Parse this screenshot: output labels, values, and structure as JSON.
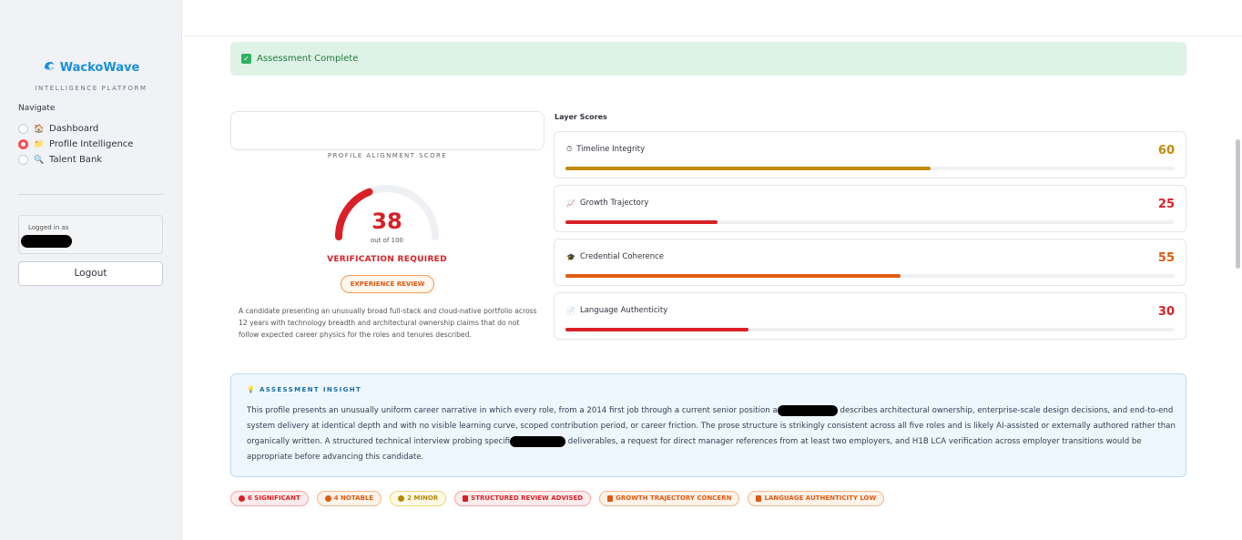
{
  "brand": {
    "name": "WackoWave",
    "subtitle": "INTELLIGENCE PLATFORM"
  },
  "nav": {
    "title": "Navigate",
    "items": [
      {
        "icon": "house-icon",
        "emoji": "🏠",
        "label": "Dashboard",
        "selected": false
      },
      {
        "icon": "folder-icon",
        "emoji": "📁",
        "label": "Profile Intelligence",
        "selected": true
      },
      {
        "icon": "magnifier-icon",
        "emoji": "🔍",
        "label": "Talent Bank",
        "selected": false
      }
    ]
  },
  "session": {
    "logged_in_label": "Logged in as",
    "logout_label": "Logout"
  },
  "alert": {
    "text": "Assessment Complete",
    "color": "#1e7a3c"
  },
  "score": {
    "label": "PROFILE ALIGNMENT SCORE",
    "value": "38",
    "value_num": 38,
    "out_of": "out of 100",
    "verdict": "VERIFICATION REQUIRED",
    "pill": "EXPERIENCE REVIEW",
    "description": "A candidate presenting an unusually broad full-stack and cloud-native portfolio across 12 years with technology breadth and architectural ownership claims that do not follow expected career physics for the roles and tenures described."
  },
  "layers": {
    "title": "Layer Scores",
    "items": [
      {
        "icon": "clock-icon",
        "emoji": "⏱",
        "label": "Timeline Integrity",
        "score": "60",
        "value": 60,
        "color": "#c48a0a"
      },
      {
        "icon": "chart-icon",
        "emoji": "📈",
        "label": "Growth Trajectory",
        "score": "25",
        "value": 25,
        "color": "#d92027"
      },
      {
        "icon": "graduation-cap-icon",
        "emoji": "🎓",
        "label": "Credential Coherence",
        "score": "55",
        "value": 55,
        "color": "#e05a12"
      },
      {
        "icon": "document-icon",
        "emoji": "📄",
        "label": "Language Authenticity",
        "score": "30",
        "value": 30,
        "color": "#d92027"
      }
    ]
  },
  "insight": {
    "title": "ASSESSMENT INSIGHT",
    "text_1": "This profile presents an unusually uniform career narrative in which every role, from a 2014 first job through a current senior position a",
    "text_2": "describes architectural ownership, enterprise-scale design decisions, and end-to-end system delivery at identical depth and with no visible learning curve, scoped contribution period, or career friction. The prose structure is strikingly consistent across all five roles and is likely AI-assisted or externally authored rather than organically written. A structured technical interview probing specifi",
    "text_3": "deliverables, a request for direct manager references from at least two employers, and H1B LCA verification across employer transitions would be appropriate before advancing this candidate."
  },
  "tags": [
    {
      "label": "6 SIGNIFICANT",
      "icon": "red-dot-icon",
      "color": "#d92027",
      "bg": "#fdecec",
      "border": "#f2a5a5"
    },
    {
      "label": "4 NOTABLE",
      "icon": "orange-dot-icon",
      "color": "#e05a12",
      "bg": "#fff3ea",
      "border": "#f5b584"
    },
    {
      "label": "2 MINOR",
      "icon": "yellow-dot-icon",
      "color": "#b8860b",
      "bg": "#fffae6",
      "border": "#f0d37a"
    },
    {
      "label": "STRUCTURED REVIEW ADVISED",
      "icon": "clipboard-icon",
      "color": "#d92027",
      "bg": "#fdecec",
      "border": "#f2a5a5"
    },
    {
      "label": "GROWTH TRAJECTORY CONCERN",
      "icon": "chart-icon",
      "color": "#e05a12",
      "bg": "#fff3ea",
      "border": "#f5b584"
    },
    {
      "label": "LANGUAGE AUTHENTICITY LOW",
      "icon": "document-icon",
      "color": "#e05a12",
      "bg": "#fff3ea",
      "border": "#f5b584"
    }
  ]
}
